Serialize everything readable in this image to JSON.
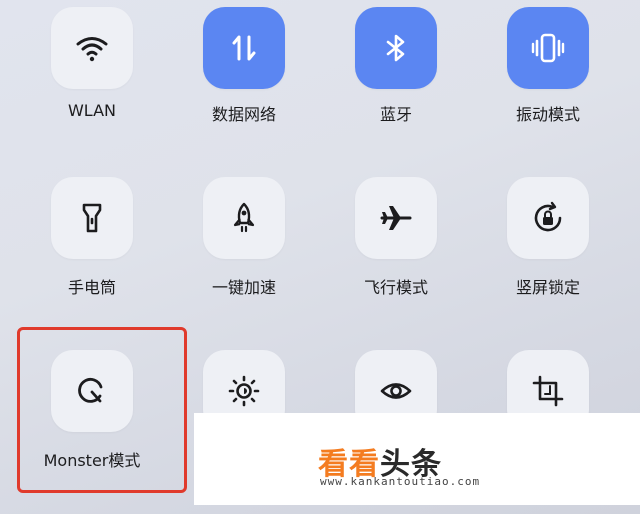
{
  "tiles": [
    {
      "label": "WLAN",
      "icon": "wifi-icon",
      "active": false
    },
    {
      "label": "数据网络",
      "icon": "data-network-icon",
      "active": true
    },
    {
      "label": "蓝牙",
      "icon": "bluetooth-icon",
      "active": true
    },
    {
      "label": "振动模式",
      "icon": "vibrate-icon",
      "active": true
    },
    {
      "label": "手电筒",
      "icon": "flashlight-icon",
      "active": false
    },
    {
      "label": "一键加速",
      "icon": "rocket-icon",
      "active": false
    },
    {
      "label": "飞行模式",
      "icon": "airplane-icon",
      "active": false
    },
    {
      "label": "竖屏锁定",
      "icon": "rotation-lock-icon",
      "active": false
    },
    {
      "label": "Monster模式",
      "icon": "monster-mode-icon",
      "active": false
    },
    {
      "label": "",
      "icon": "brightness-icon",
      "active": false
    },
    {
      "label": "",
      "icon": "eye-icon",
      "active": false
    },
    {
      "label": "",
      "icon": "screenshot-crop-icon",
      "active": false
    }
  ],
  "colors": {
    "active_tile": "#5b86f2",
    "inactive_tile": "#eef0f5",
    "highlight": "#e03a2c",
    "watermark_accent": "#f47c20"
  },
  "watermark": {
    "part1": "看看",
    "part2": "头条",
    "url": "www.kankantoutiao.com"
  }
}
